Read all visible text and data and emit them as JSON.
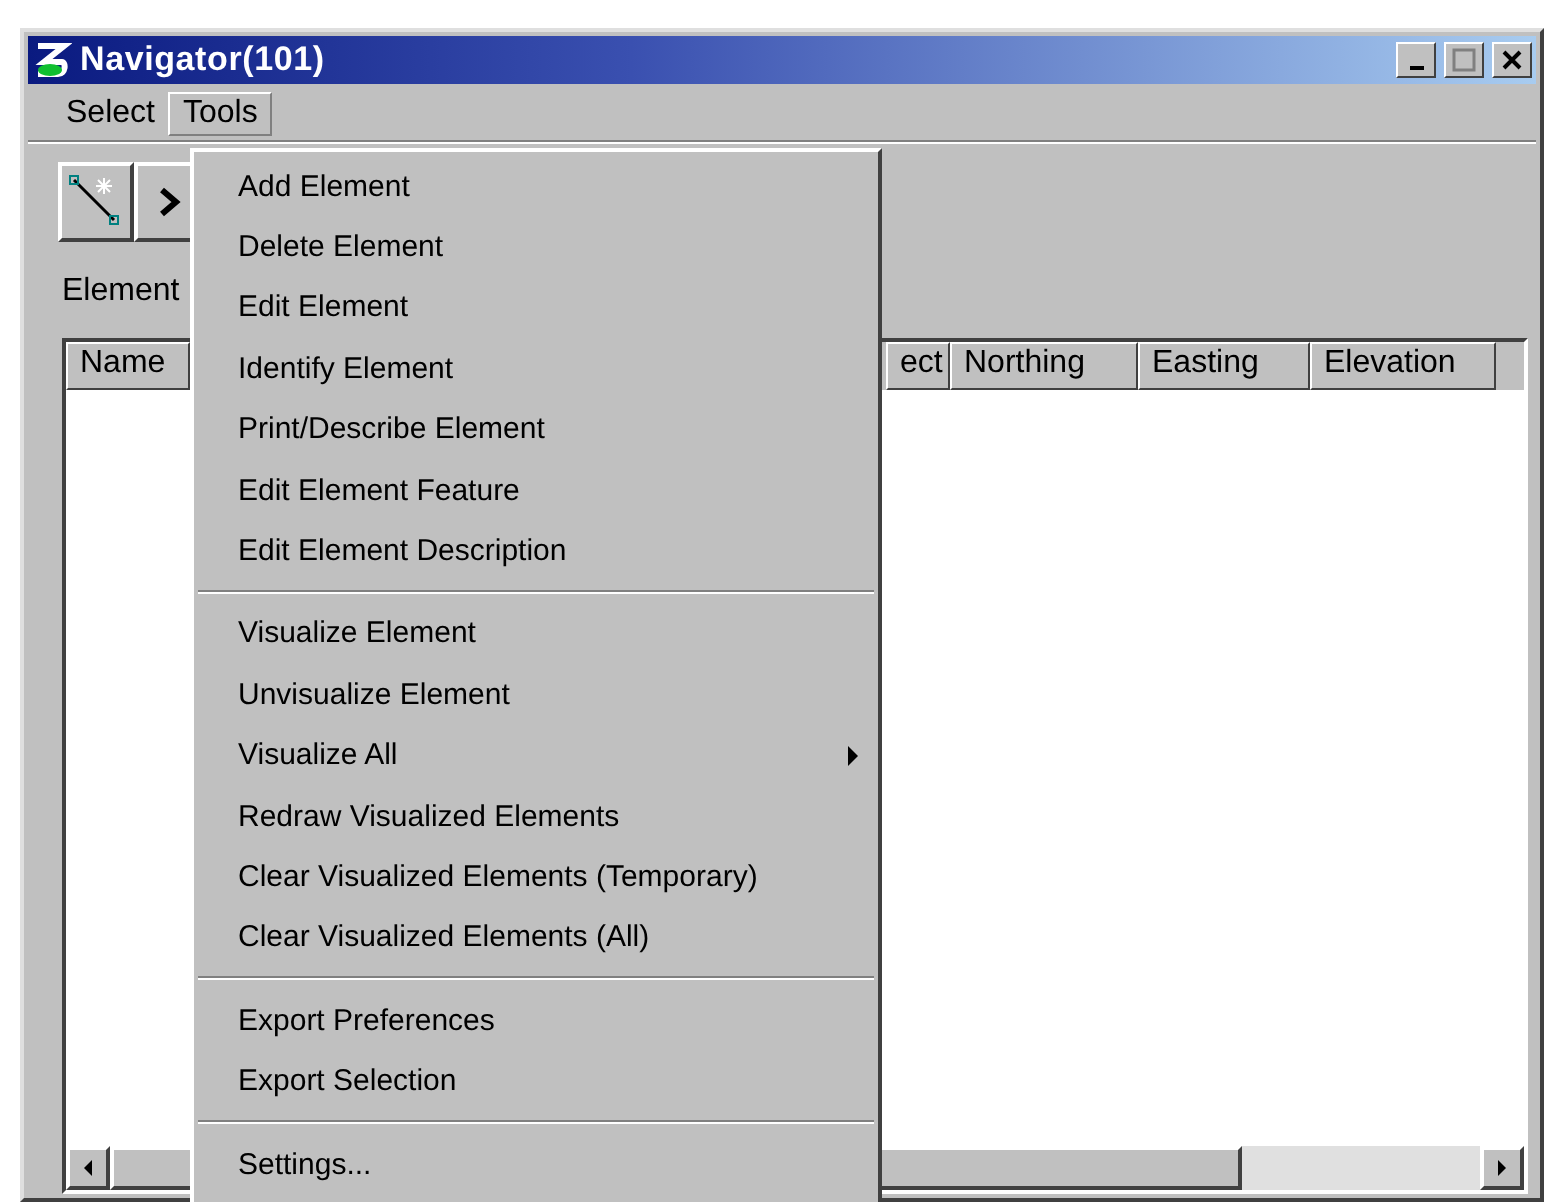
{
  "window": {
    "title": "Navigator(101)"
  },
  "menubar": [
    {
      "label": "Select",
      "selected": false
    },
    {
      "label": "Tools",
      "selected": true
    }
  ],
  "element_label": "Element",
  "table": {
    "columns": [
      {
        "label": "Name"
      },
      {
        "label": "ect"
      },
      {
        "label": "Northing"
      },
      {
        "label": "Easting"
      },
      {
        "label": "Elevation"
      }
    ]
  },
  "menu": {
    "items": [
      {
        "kind": "item",
        "label": "Add Element",
        "submenu": false
      },
      {
        "kind": "item",
        "label": "Delete Element",
        "submenu": false
      },
      {
        "kind": "item",
        "label": "Edit Element",
        "submenu": false
      },
      {
        "kind": "item",
        "label": "Identify Element",
        "submenu": false
      },
      {
        "kind": "item",
        "label": "Print/Describe Element",
        "submenu": false
      },
      {
        "kind": "item",
        "label": "Edit Element Feature",
        "submenu": false
      },
      {
        "kind": "item",
        "label": "Edit Element Description",
        "submenu": false
      },
      {
        "kind": "separator"
      },
      {
        "kind": "item",
        "label": "Visualize Element",
        "submenu": false
      },
      {
        "kind": "item",
        "label": "Unvisualize Element",
        "submenu": false
      },
      {
        "kind": "item",
        "label": "Visualize All",
        "submenu": true
      },
      {
        "kind": "item",
        "label": "Redraw Visualized Elements",
        "submenu": false
      },
      {
        "kind": "item",
        "label": "Clear Visualized Elements (Temporary)",
        "submenu": false
      },
      {
        "kind": "item",
        "label": "Clear Visualized Elements (All)",
        "submenu": false
      },
      {
        "kind": "separator"
      },
      {
        "kind": "item",
        "label": "Export Preferences",
        "submenu": false
      },
      {
        "kind": "item",
        "label": "Export Selection",
        "submenu": false
      },
      {
        "kind": "separator"
      },
      {
        "kind": "item",
        "label": "Settings...",
        "submenu": false
      }
    ]
  }
}
